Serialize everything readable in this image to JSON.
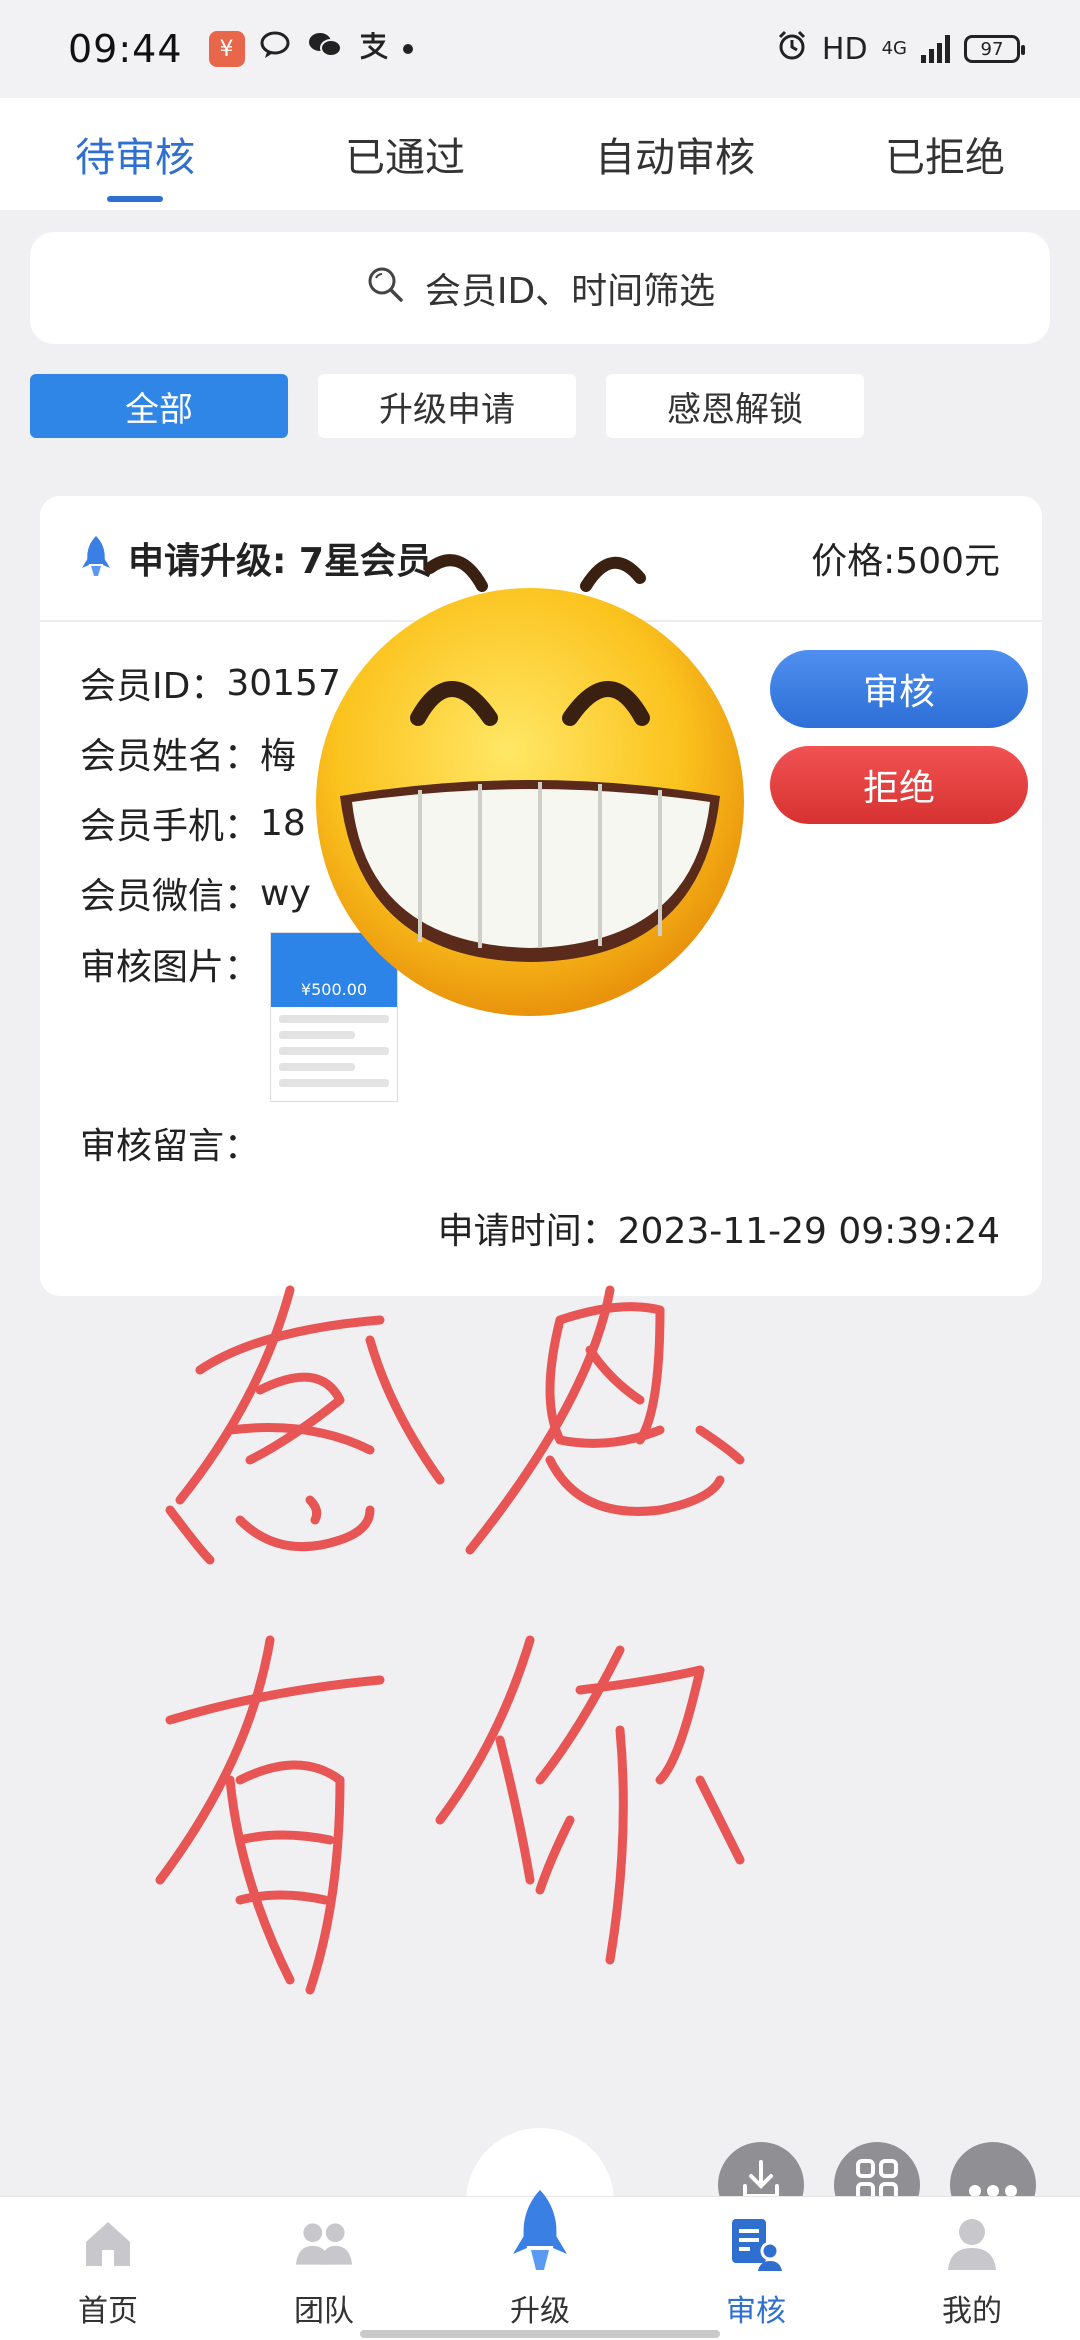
{
  "status_bar": {
    "time": "09:44",
    "hd": "HD",
    "network": "4G",
    "battery": "97",
    "icons": [
      "app-badge-icon",
      "chat-bubble-icon",
      "wechat-icon",
      "alipay-icon",
      "dot-icon",
      "alarm-icon",
      "signal-icon",
      "battery-icon"
    ]
  },
  "tabs": [
    {
      "label": "待审核",
      "active": true
    },
    {
      "label": "已通过",
      "active": false
    },
    {
      "label": "自动审核",
      "active": false
    },
    {
      "label": "已拒绝",
      "active": false
    }
  ],
  "search": {
    "placeholder": "会员ID、时间筛选"
  },
  "filters": [
    {
      "label": "全部",
      "active": true
    },
    {
      "label": "升级申请",
      "active": false
    },
    {
      "label": "感恩解锁",
      "active": false
    }
  ],
  "card": {
    "title": "申请升级: 7星会员",
    "price": "价格:500元",
    "rows": [
      {
        "label": "会员ID：",
        "value": "30157"
      },
      {
        "label": "会员姓名：",
        "value": "梅"
      },
      {
        "label": "会员手机：",
        "value": "18"
      },
      {
        "label": "会员微信：",
        "value": "wy"
      }
    ],
    "image_label": "审核图片：",
    "image_amount": "¥500.00",
    "message_label": "审核留言：",
    "message_value": "",
    "apply_time": "申请时间：2023-11-29 09:39:24",
    "approve_label": "审核",
    "reject_label": "拒绝"
  },
  "handwriting": {
    "line1": "感恩",
    "line2": "有你"
  },
  "bottom_nav": [
    {
      "label": "首页",
      "active": false
    },
    {
      "label": "团队",
      "active": false
    },
    {
      "label": "升级",
      "active": false
    },
    {
      "label": "审核",
      "active": true
    },
    {
      "label": "我的",
      "active": false
    }
  ],
  "colors": {
    "accent": "#2f6fd0",
    "filter_active": "#2f86e6",
    "approve": "#3a7fe3",
    "reject": "#e03e3e",
    "handwriting": "#e85555"
  }
}
